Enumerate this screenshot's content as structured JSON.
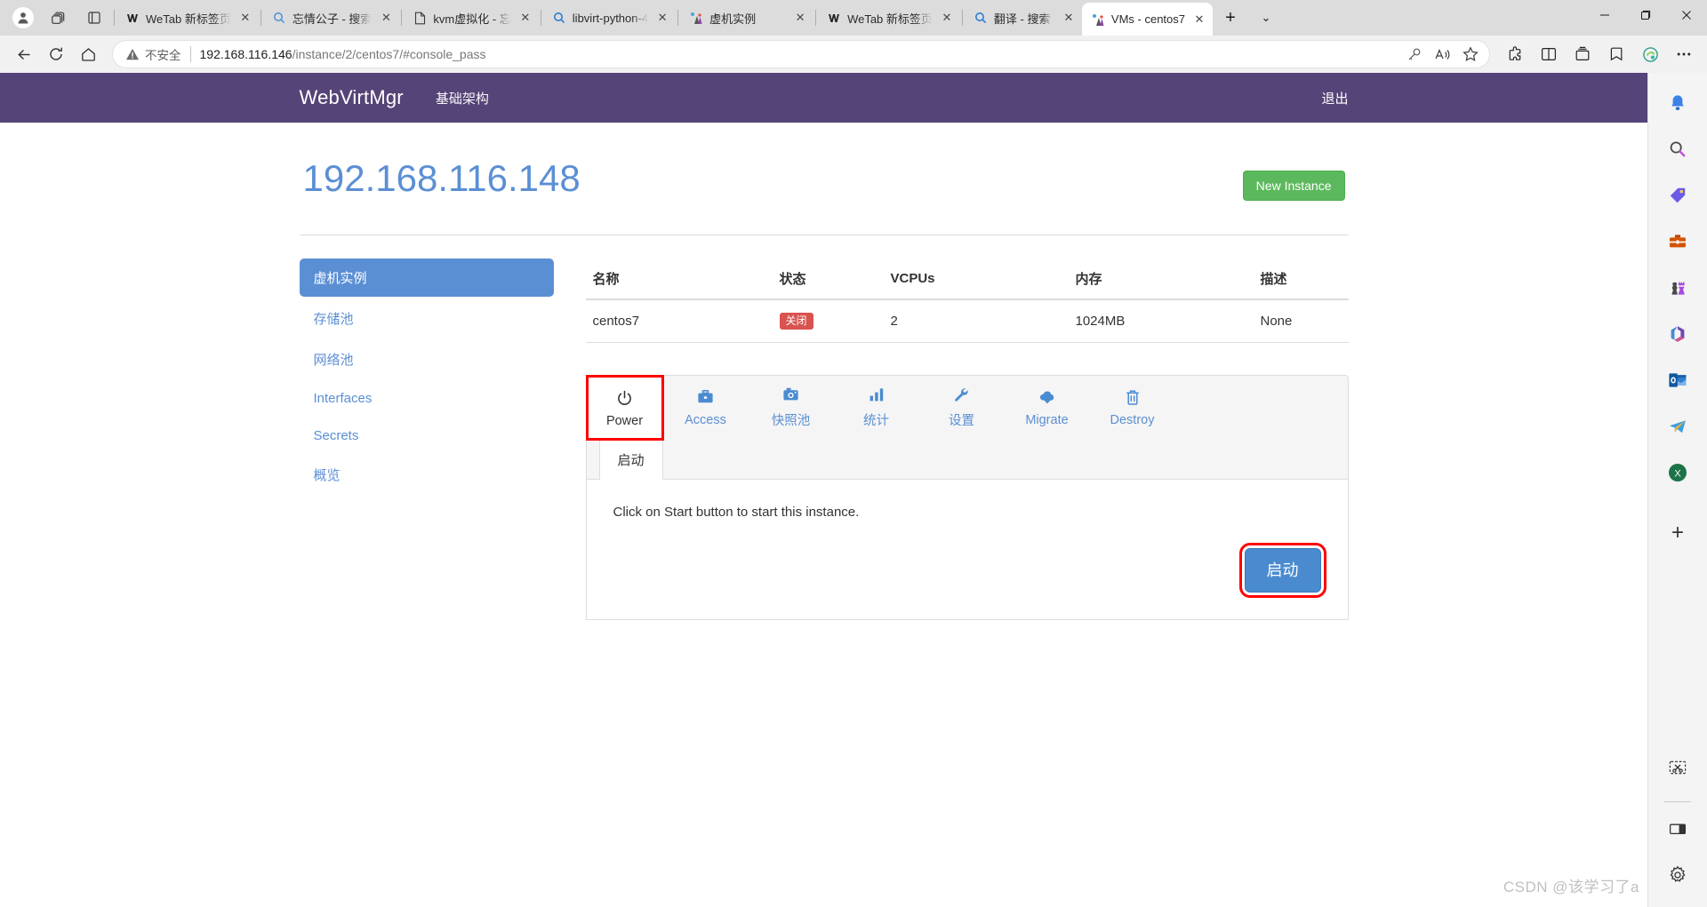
{
  "browser": {
    "tabs": [
      {
        "title": "WeTab 新标签页",
        "favicon": "wetab-icon",
        "active": false
      },
      {
        "title": "忘情公子 - 搜索",
        "favicon": "search-icon",
        "active": false
      },
      {
        "title": "kvm虚拟化 - 忘",
        "favicon": "page-icon",
        "active": false
      },
      {
        "title": "libvirt-python-4",
        "favicon": "search-icon",
        "active": false
      },
      {
        "title": "虚机实例",
        "favicon": "webvirtmgr-icon",
        "active": false
      },
      {
        "title": "WeTab 新标签页",
        "favicon": "wetab-icon",
        "active": false
      },
      {
        "title": "翻译 - 搜索",
        "favicon": "search-icon",
        "active": false
      },
      {
        "title": "VMs - centos7",
        "favicon": "webvirtmgr-icon",
        "active": true
      }
    ],
    "tab_close_label": "✕",
    "new_tab_label": "+",
    "tab_list_label": "⌄",
    "window_controls": {
      "minimize": "—",
      "maximize": "❐",
      "close": "✕"
    },
    "nav": {
      "back": "←",
      "refresh": "⟳",
      "home": "⌂"
    },
    "address": {
      "security_label": "不安全",
      "url_host": "192.168.116.146",
      "url_path": "/instance/2/centos7/#console_pass"
    },
    "address_icons": [
      "key-icon",
      "read-aloud-icon",
      "favorite-star-icon"
    ],
    "toolbar_icons": [
      "extensions-icon",
      "split-screen-icon",
      "collections-icon",
      "favorites-icon",
      "browser-essentials-icon",
      "settings-more-icon"
    ]
  },
  "page": {
    "navbar": {
      "brand": "WebVirtMgr",
      "links": [
        "基础架构"
      ],
      "logout": "退出"
    },
    "title": "192.168.116.148",
    "new_instance_button": "New Instance",
    "sidebar": {
      "items": [
        {
          "label": "虚机实例",
          "active": true
        },
        {
          "label": "存储池",
          "active": false
        },
        {
          "label": "网络池",
          "active": false
        },
        {
          "label": "Interfaces",
          "active": false
        },
        {
          "label": "Secrets",
          "active": false
        },
        {
          "label": "概览",
          "active": false
        }
      ]
    },
    "table": {
      "headers": [
        "名称",
        "状态",
        "VCPUs",
        "内存",
        "描述"
      ],
      "rows": [
        {
          "name": "centos7",
          "state": "关闭",
          "vcpus": "2",
          "memory": "1024MB",
          "description": "None"
        }
      ]
    },
    "tabs": [
      {
        "label": "Power",
        "icon": "power-icon",
        "active": true,
        "highlighted": true
      },
      {
        "label": "Access",
        "icon": "briefcase-icon",
        "active": false,
        "highlighted": false
      },
      {
        "label": "快照池",
        "icon": "camera-icon",
        "active": false,
        "highlighted": false
      },
      {
        "label": "统计",
        "icon": "bar-chart-icon",
        "active": false,
        "highlighted": false
      },
      {
        "label": "设置",
        "icon": "wrench-icon",
        "active": false,
        "highlighted": false
      },
      {
        "label": "Migrate",
        "icon": "cloud-download-icon",
        "active": false,
        "highlighted": false
      },
      {
        "label": "Destroy",
        "icon": "trash-icon",
        "active": false,
        "highlighted": false
      }
    ],
    "inner_tabs": [
      {
        "label": "启动",
        "active": true
      }
    ],
    "panel": {
      "message": "Click on Start button to start this instance.",
      "start_button": "启动"
    },
    "colors": {
      "navbar": "#554477",
      "title": "#5b8fd4",
      "new_instance": "#5cb85c",
      "badge_danger": "#d9534f",
      "start_button": "#4a8bd0",
      "highlight": "#ff0000"
    }
  },
  "edge_sidebar": {
    "icons": [
      "copilot-bell-icon",
      "search-icon",
      "shopping-tag-icon",
      "briefcase-icon",
      "games-icon",
      "microsoft365-icon",
      "outlook-icon",
      "telegram-icon",
      "excel-icon"
    ],
    "add_label": "+",
    "bottom_icons": [
      "screenshot-icon",
      "split-pane-icon",
      "settings-gear-icon"
    ]
  },
  "watermark": "CSDN @该学习了a"
}
